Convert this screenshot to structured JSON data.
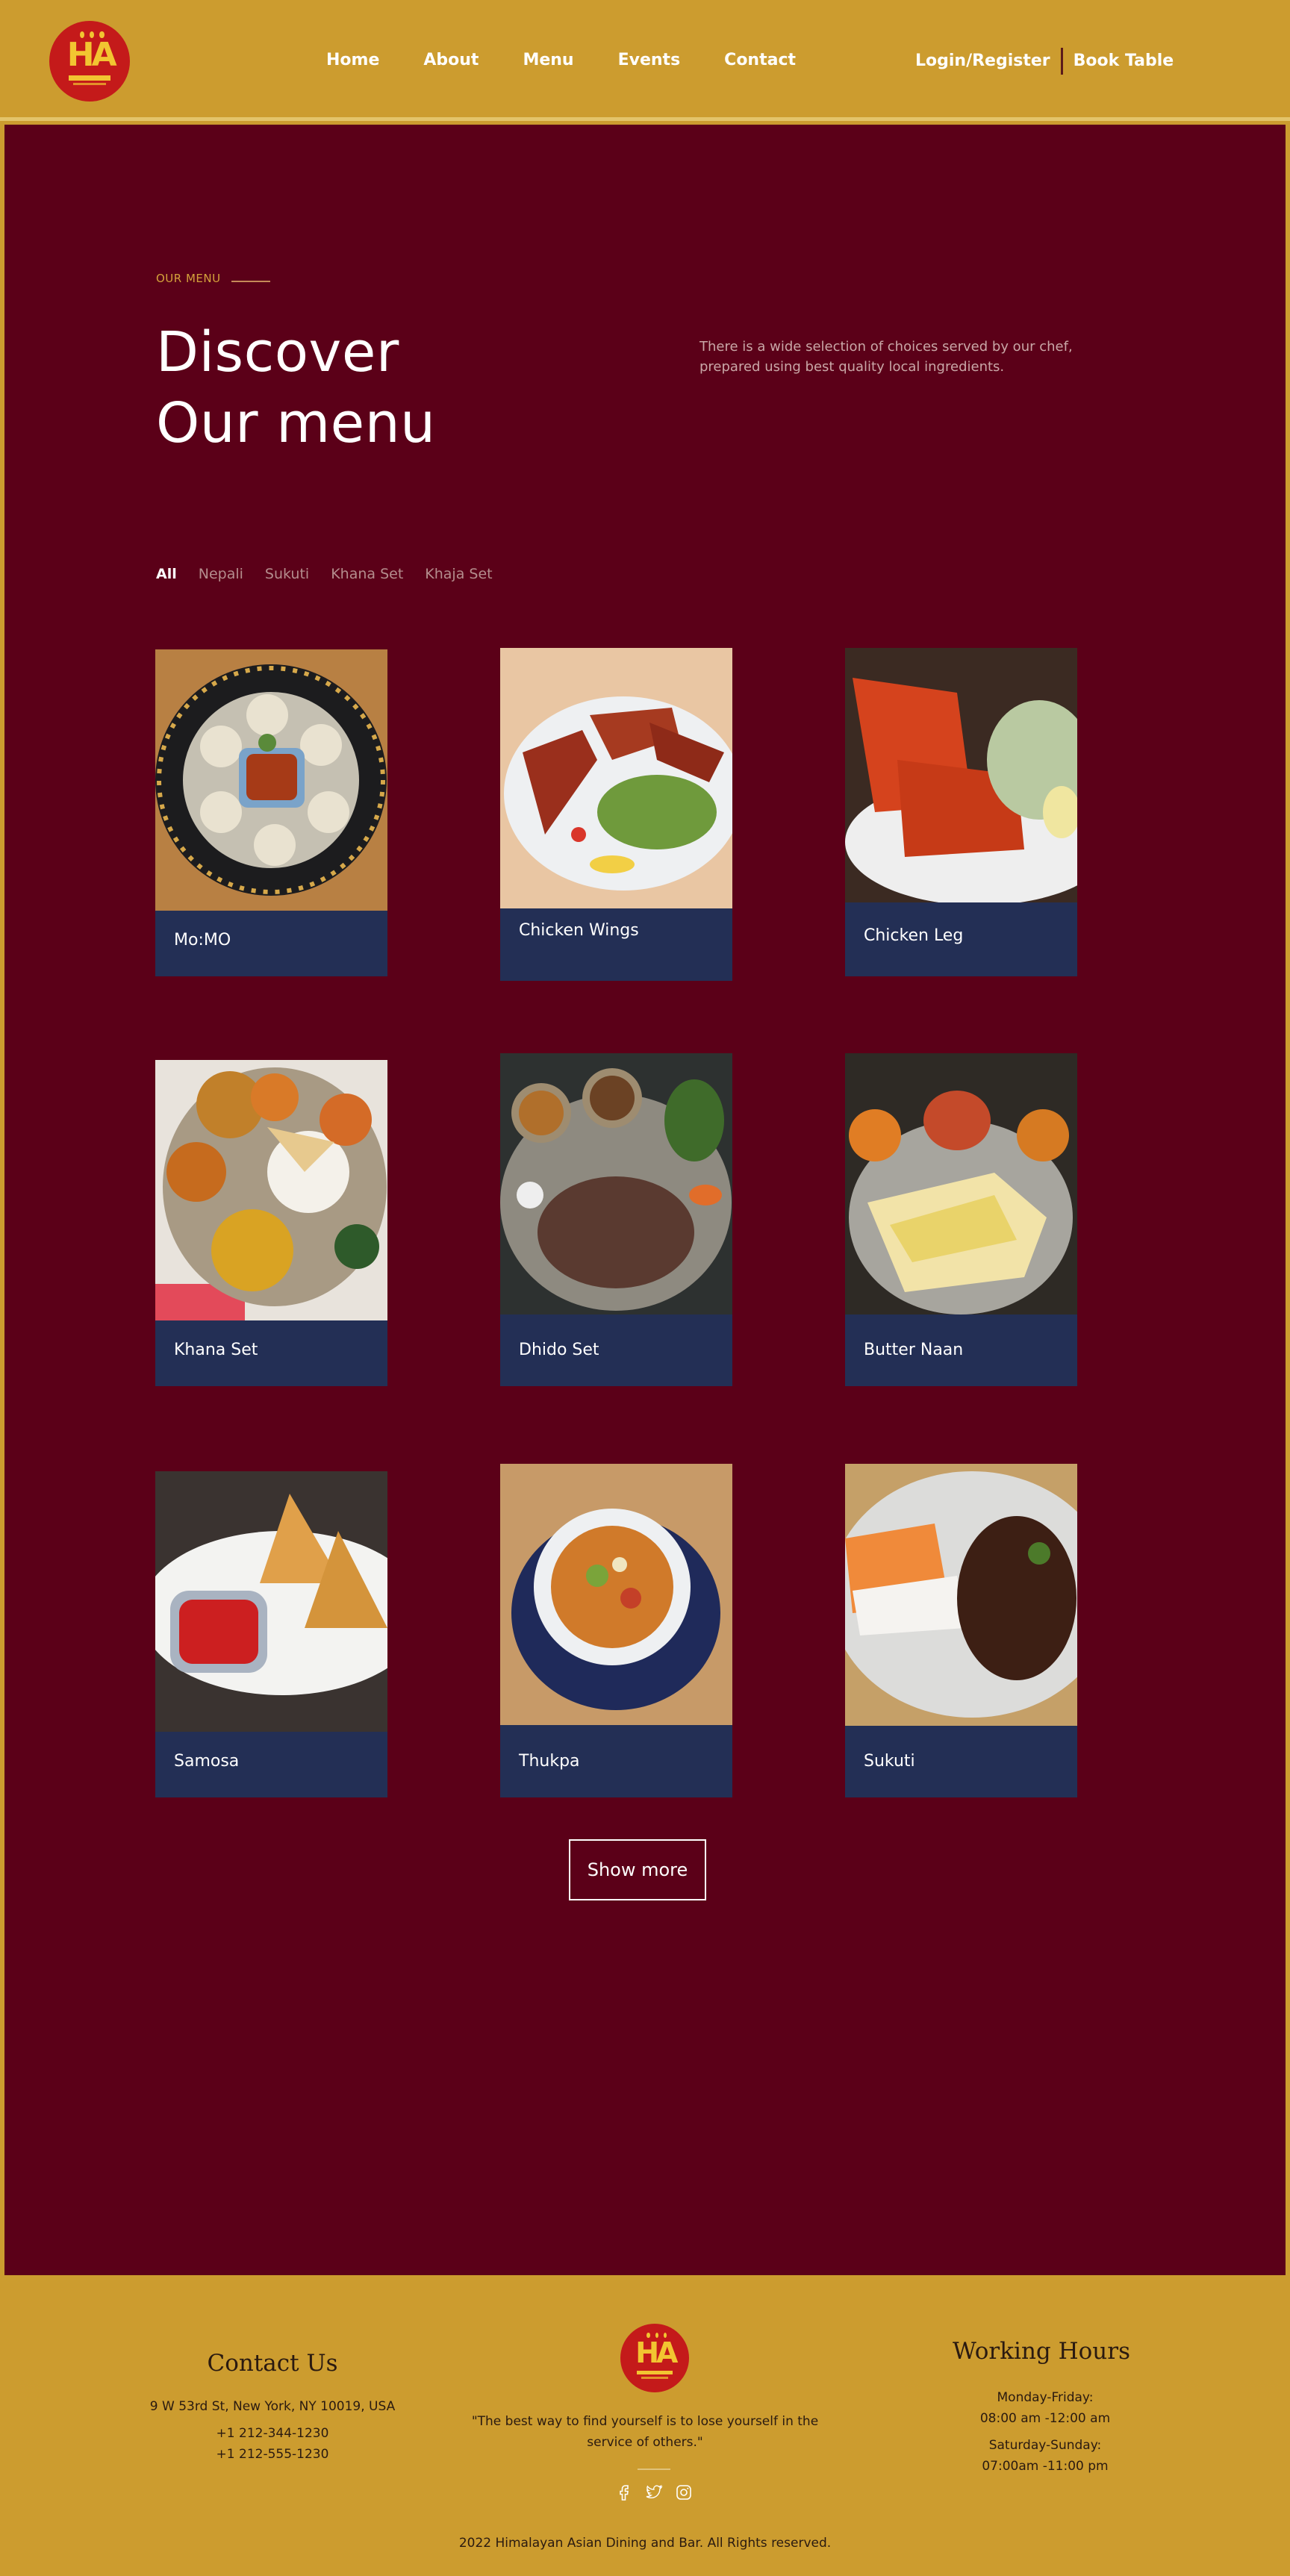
{
  "header": {
    "logo_icon": "himalayan-asian-logo",
    "nav": [
      "Home",
      "About",
      "Menu",
      "Events",
      "Contact"
    ],
    "login_label": "Login/Register",
    "book_label": "Book Table"
  },
  "menu_section": {
    "eyebrow": "OUR MENU",
    "heading_line1": "Discover",
    "heading_line2": "Our menu",
    "intro": "There is a wide selection of choices served by our chef, prepared using best quality local ingredients.",
    "filters": [
      "All",
      "Nepali",
      "Sukuti",
      "Khana Set",
      "Khaja Set"
    ],
    "active_filter": "All",
    "items": [
      {
        "name": "Mo:MO",
        "photo": "momo-plate-photo"
      },
      {
        "name": "Chicken Wings",
        "photo": "chicken-wings-photo"
      },
      {
        "name": "Chicken Leg",
        "photo": "chicken-leg-photo"
      },
      {
        "name": "Khana Set",
        "photo": "khana-set-photo"
      },
      {
        "name": "Dhido Set",
        "photo": "dhido-set-photo"
      },
      {
        "name": "Butter Naan",
        "photo": "butter-naan-photo"
      },
      {
        "name": "Samosa",
        "photo": "samosa-photo"
      },
      {
        "name": "Thukpa",
        "photo": "thukpa-photo"
      },
      {
        "name": "Sukuti",
        "photo": "sukuti-photo"
      }
    ],
    "show_more_label": "Show more"
  },
  "footer": {
    "contact_title": "Contact Us",
    "address": "9 W 53rd St, New York, NY 10019, USA",
    "phone1": "+1 212-344-1230",
    "phone2": "+1 212-555-1230",
    "quote_line1": "\"The best way to find yourself is to lose yourself in the",
    "quote_line2": "service of others.\"",
    "socials": [
      "facebook-icon",
      "twitter-icon",
      "instagram-icon"
    ],
    "hours_title": "Working Hours",
    "weekday_label": "Monday-Friday:",
    "weekday_hours": "08:00 am -12:00 am",
    "weekend_label": "Saturday-Sunday:",
    "weekend_hours": "07:00am -11:00 pm",
    "copyright": "2022 Himalayan Asian Dining and Bar. All Rights reserved."
  },
  "colors": {
    "gold": "#cc9c2f",
    "maroon": "#5b0018",
    "navy": "#232f55"
  }
}
